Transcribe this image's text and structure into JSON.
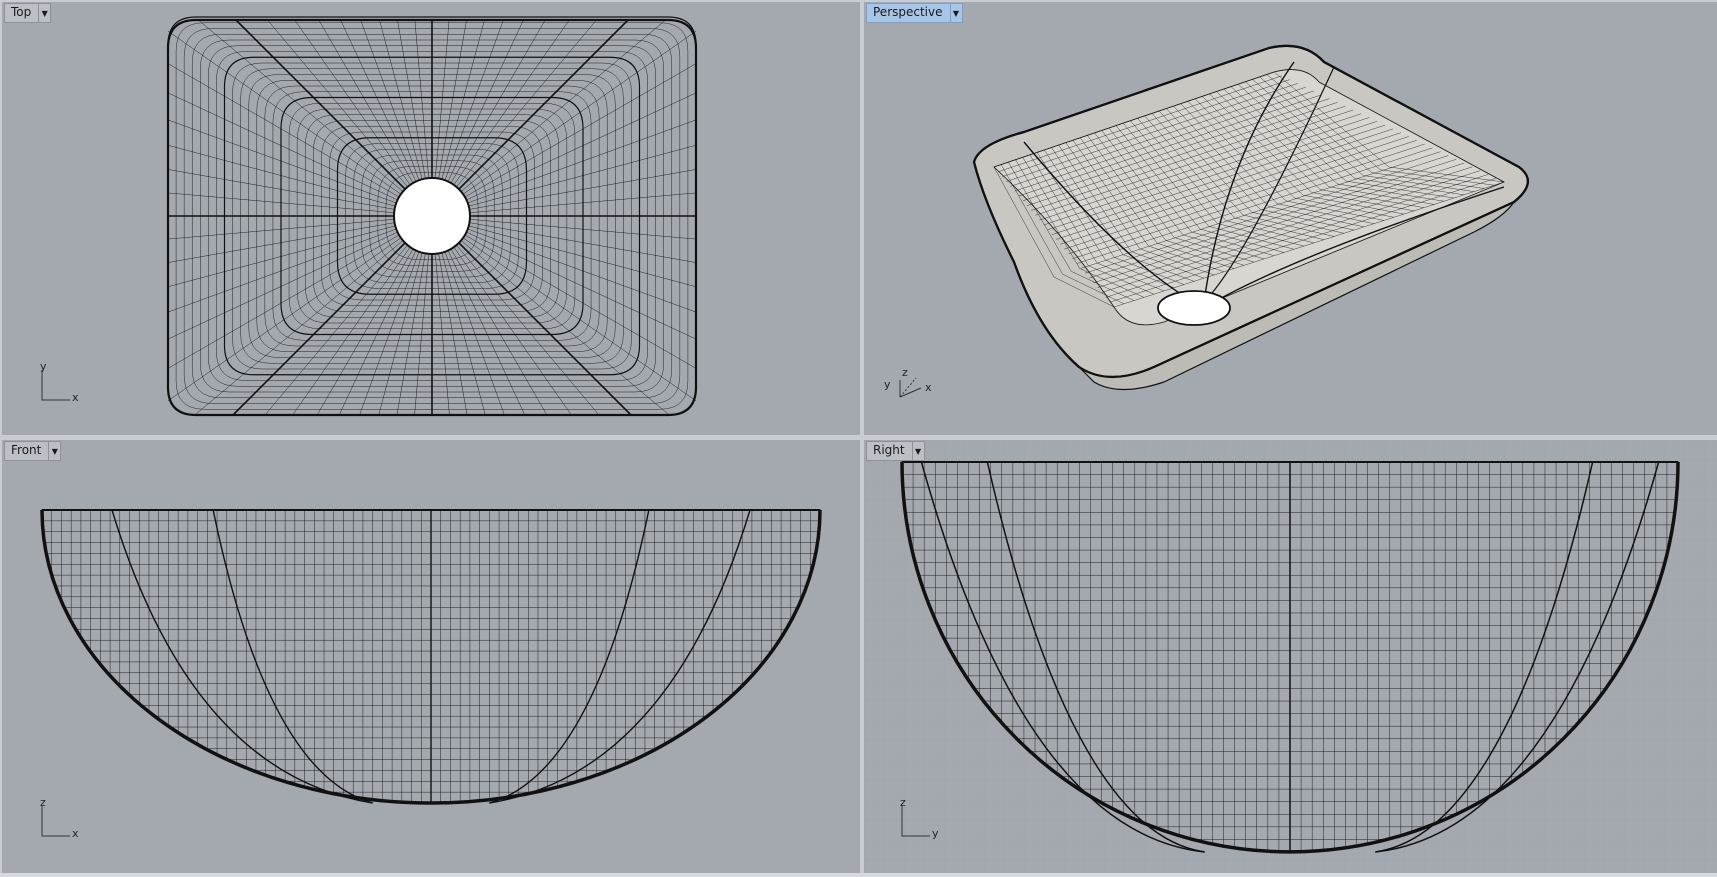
{
  "viewports": {
    "top": {
      "label": "Top",
      "axis_a": "y",
      "axis_b": "x"
    },
    "persp": {
      "label": "Perspective",
      "axis_a": "z",
      "axis_b": "x",
      "axis_c": "y"
    },
    "front": {
      "label": "Front",
      "axis_a": "z",
      "axis_b": "x"
    },
    "right": {
      "label": "Right",
      "axis_a": "z",
      "axis_b": "y"
    }
  },
  "colors": {
    "viewport_bg": "#a4a9b0",
    "active_tab": "#a7c5e9",
    "mesh_line": "#111111",
    "surface_fill": "#c9c7c2"
  },
  "dropdown_icon": "caret-down-icon"
}
